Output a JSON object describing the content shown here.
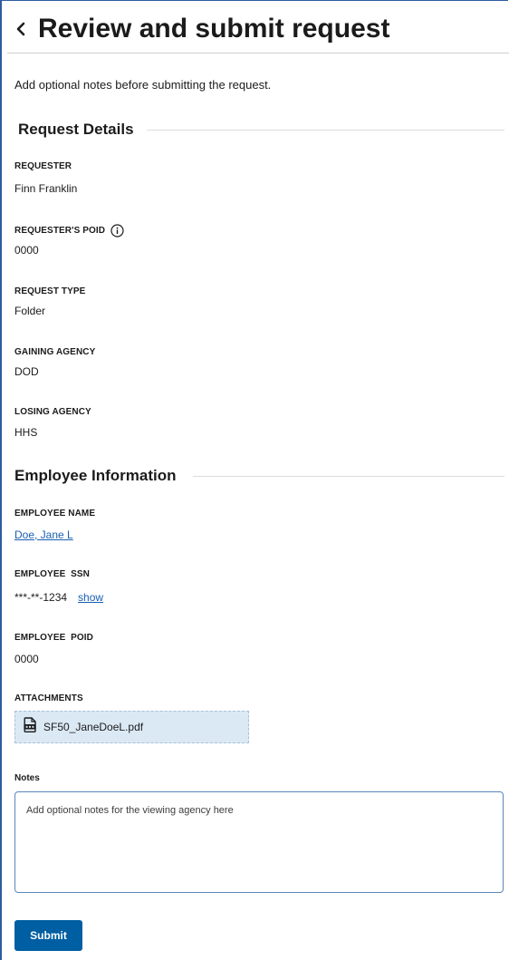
{
  "header": {
    "title": "Review and submit request",
    "back_icon": "chevron-left-icon"
  },
  "intro": "Add optional notes before submitting the request.",
  "request_details": {
    "heading": "Request Details",
    "fields": [
      {
        "label": "REQUESTER",
        "value": "Finn Franklin"
      },
      {
        "label": "REQUESTER'S POID",
        "value": "0000",
        "icon": "info-icon"
      },
      {
        "label": "REQUEST TYPE",
        "value": "Folder"
      },
      {
        "label": "GAINING AGENCY",
        "value": "DOD"
      },
      {
        "label": "LOSING AGENCY",
        "value": "HHS"
      }
    ]
  },
  "employee_information": {
    "heading": "Employee Information",
    "name": {
      "label": "EMPLOYEE NAME",
      "value": "Doe, Jane L"
    },
    "ssn": {
      "label": "EMPLOYEE  SSN",
      "value": "***-**-1234",
      "show_label": "show"
    },
    "poid": {
      "label": "EMPLOYEE  POID",
      "value": "0000"
    },
    "attachments": {
      "label": "ATTACHMENTS",
      "file_name": "SF50_JaneDoeL.pdf",
      "icon": "pdf-file-icon"
    }
  },
  "notes": {
    "label": "Notes",
    "placeholder": "Add optional notes for the viewing agency here",
    "value": ""
  },
  "submit_label": "Submit",
  "colors": {
    "primary": "#005ea2",
    "link": "#1a5fb4",
    "attachment_bg": "#dbe9f5",
    "frame_border": "#2f5b9e"
  }
}
